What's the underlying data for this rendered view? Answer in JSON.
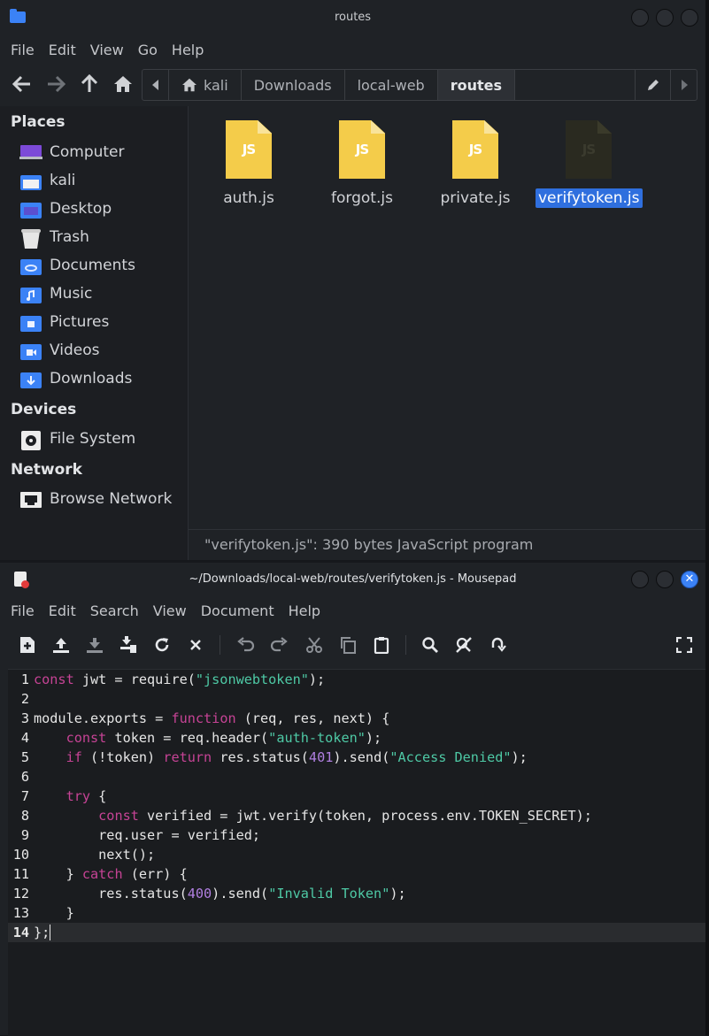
{
  "file_manager": {
    "title": "routes",
    "menu": [
      "File",
      "Edit",
      "View",
      "Go",
      "Help"
    ],
    "path": [
      "kali",
      "Downloads",
      "local-web",
      "routes"
    ],
    "sidebar": {
      "places_heading": "Places",
      "places": [
        "Computer",
        "kali",
        "Desktop",
        "Trash",
        "Documents",
        "Music",
        "Pictures",
        "Videos",
        "Downloads"
      ],
      "devices_heading": "Devices",
      "devices": [
        "File System"
      ],
      "network_heading": "Network",
      "network": [
        "Browse Network"
      ]
    },
    "files": [
      "auth.js",
      "forgot.js",
      "private.js",
      "verifytoken.js"
    ],
    "file_icon_label": "JS",
    "status": "\"verifytoken.js\": 390 bytes JavaScript program"
  },
  "editor": {
    "title": "~/Downloads/local-web/routes/verifytoken.js - Mousepad",
    "menu": [
      "File",
      "Edit",
      "Search",
      "View",
      "Document",
      "Help"
    ],
    "close_glyph": "✕",
    "line_numbers": [
      "1",
      "2",
      "3",
      "4",
      "5",
      "6",
      "7",
      "8",
      "9",
      "10",
      "11",
      "12",
      "13",
      "14"
    ],
    "code": [
      "const jwt = require(\"jsonwebtoken\");",
      "",
      "module.exports = function (req, res, next) {",
      "    const token = req.header(\"auth-token\");",
      "    if (!token) return res.status(401).send(\"Access Denied\");",
      "",
      "    try {",
      "        const verified = jwt.verify(token, process.env.TOKEN_SECRET);",
      "        req.user = verified;",
      "        next();",
      "    } catch (err) {",
      "        res.status(400).send(\"Invalid Token\");",
      "    }",
      "};"
    ]
  }
}
